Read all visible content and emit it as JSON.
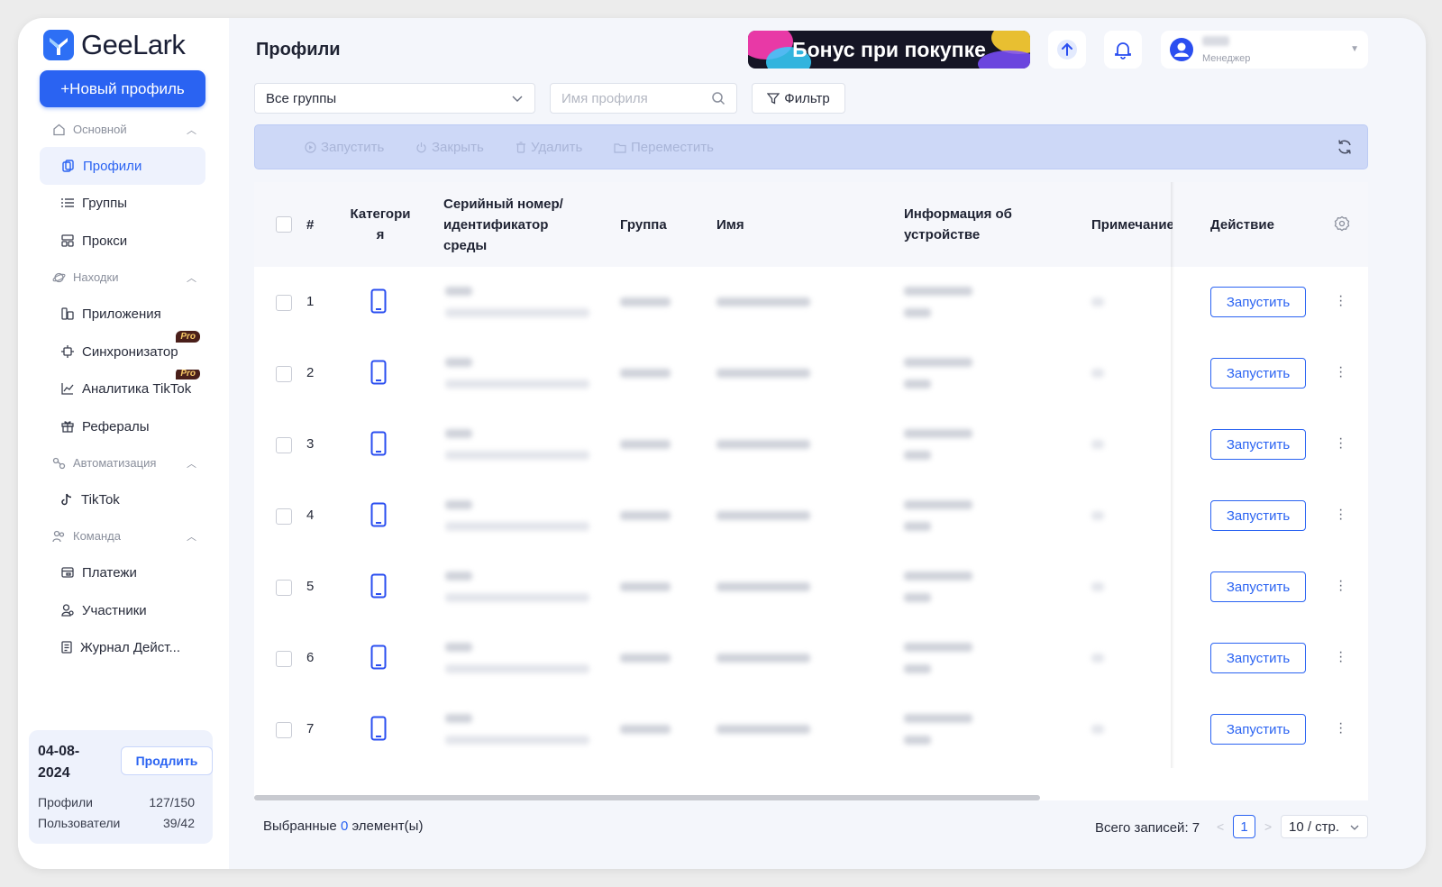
{
  "app": {
    "logo_text": "GeeLark",
    "page_title": "Профили"
  },
  "sidebar": {
    "new_profile_button": "+Новый профиль",
    "sections": [
      {
        "label": "Основной",
        "items": [
          "Профили",
          "Группы",
          "Прокси"
        ]
      },
      {
        "label": "Находки",
        "items": [
          "Приложения",
          "Синхронизатор",
          "Аналитика TikTok",
          "Рефералы"
        ]
      },
      {
        "label": "Автоматизация",
        "items": [
          "TikTok"
        ]
      },
      {
        "label": "Команда",
        "items": [
          "Платежи",
          "Участники",
          "Журнал Дейст..."
        ]
      }
    ],
    "pro_badge": "Pro",
    "active_item": "Профили"
  },
  "plan": {
    "date": "04-08-2024",
    "extend_button": "Продлить",
    "rows": [
      {
        "label": "Профили",
        "value": "127/150"
      },
      {
        "label": "Пользователи",
        "value": "39/42"
      }
    ]
  },
  "header": {
    "banner_text": "Бонус при покупке",
    "user_role": "Менеджер"
  },
  "filters": {
    "group_select": "Все группы",
    "search_placeholder": "Имя профиля",
    "filter_button": "Фильтр"
  },
  "toolbar": {
    "start": "Запустить",
    "close": "Закрыть",
    "delete": "Удалить",
    "move": "Переместить"
  },
  "table": {
    "columns": {
      "num": "#",
      "category": "Категори я",
      "serial": "Серийный номер/ идентификатор среды",
      "group": "Группа",
      "name": "Имя",
      "device": "Информация об устройстве",
      "note": "Примечание",
      "action": "Действие"
    },
    "rows": [
      {
        "num": "1",
        "action": "Запустить"
      },
      {
        "num": "2",
        "action": "Запустить"
      },
      {
        "num": "3",
        "action": "Запустить"
      },
      {
        "num": "4",
        "action": "Запустить"
      },
      {
        "num": "5",
        "action": "Запустить"
      },
      {
        "num": "6",
        "action": "Запустить"
      },
      {
        "num": "7",
        "action": "Запустить"
      }
    ]
  },
  "footer": {
    "selected_prefix": "Выбранные",
    "selected_count": "0",
    "selected_suffix": "элемент(ы)",
    "total": "Всего записей: 7",
    "current_page": "1",
    "page_size": "10 / стр."
  },
  "colors": {
    "accent": "#2a63f2",
    "toolbar_bg": "#cdd8f7",
    "pro_badge_bg": "#4a1f1a"
  }
}
